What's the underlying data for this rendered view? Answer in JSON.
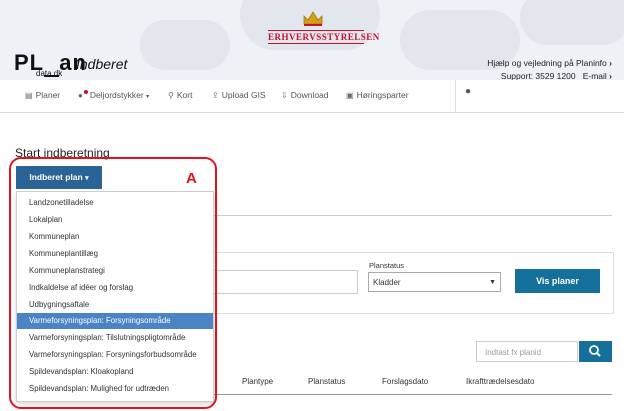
{
  "header": {
    "agency": "Erhvervsstyrelsen",
    "logo_main": "PL_an",
    "logo_sub": "data.dk",
    "page_title": "Indberet",
    "help_text": "Hjælp og vejledning på Planinfo",
    "support_text": "Support: 3529 1200",
    "email_text": "E-mail"
  },
  "nav": {
    "items": [
      {
        "label": "Planer",
        "icon": "document-icon"
      },
      {
        "label": "Deljordstykker",
        "icon": "location-icon"
      },
      {
        "label": "Kort",
        "icon": "map-marker-icon"
      },
      {
        "label": "Upload GIS",
        "icon": "upload-icon"
      },
      {
        "label": "Download",
        "icon": "download-icon"
      },
      {
        "label": "Høringsparter",
        "icon": "contacts-icon"
      }
    ],
    "user_icon": "user-icon"
  },
  "main": {
    "title": "Start indberetning",
    "dropdown_label": "Indberet plan",
    "dropdown_items": [
      "Landzonetilladelse",
      "Lokalplan",
      "Kommuneplan",
      "Kommuneplantillæg",
      "Kommuneplanstrategi",
      "Indkaldelse af idéer og forslag",
      "Udbygningsaftale",
      "Varmeforsyningsplan: Forsyningsområde",
      "Varmeforsyningsplan: Tilslutningspligtområde",
      "Varmeforsyningsplan: Forsyningsforbudsområde",
      "Spildevandsplan: Kloakopland",
      "Spildevandsplan: Mulighed for udtræden"
    ],
    "active_item": "Varmeforsyningsplan: Forsyningsområde",
    "annotation_label": "A",
    "planstatus_label": "Planstatus",
    "planstatus_value": "Kladder",
    "vis_button": "Vis planer",
    "search_placeholder": "Indtast fx planid",
    "columns": [
      "Plantype",
      "Planstatus",
      "Forslagsdato",
      "Ikrafttrædelsesdato"
    ]
  },
  "colors": {
    "accent_blue": "#14709a",
    "dropdown_blue": "#2a6496",
    "highlight": "#4a84c4",
    "annotation_red": "#e0141e",
    "brand_red": "#c8102e"
  }
}
